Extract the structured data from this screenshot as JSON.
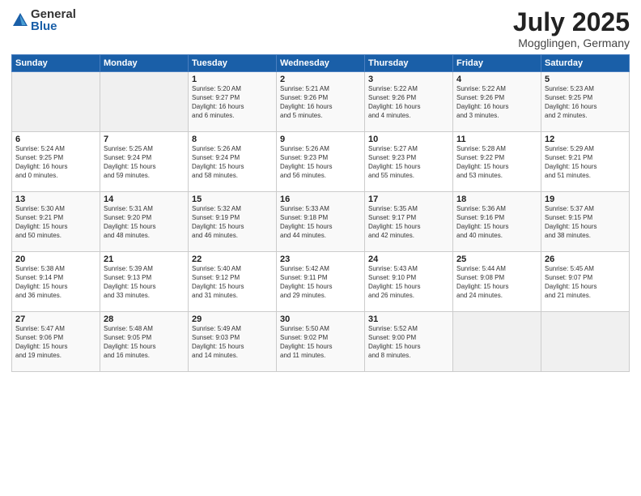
{
  "header": {
    "logo_general": "General",
    "logo_blue": "Blue",
    "month_year": "July 2025",
    "location": "Mogglingen, Germany"
  },
  "weekdays": [
    "Sunday",
    "Monday",
    "Tuesday",
    "Wednesday",
    "Thursday",
    "Friday",
    "Saturday"
  ],
  "weeks": [
    [
      {
        "day": "",
        "info": ""
      },
      {
        "day": "",
        "info": ""
      },
      {
        "day": "1",
        "info": "Sunrise: 5:20 AM\nSunset: 9:27 PM\nDaylight: 16 hours\nand 6 minutes."
      },
      {
        "day": "2",
        "info": "Sunrise: 5:21 AM\nSunset: 9:26 PM\nDaylight: 16 hours\nand 5 minutes."
      },
      {
        "day": "3",
        "info": "Sunrise: 5:22 AM\nSunset: 9:26 PM\nDaylight: 16 hours\nand 4 minutes."
      },
      {
        "day": "4",
        "info": "Sunrise: 5:22 AM\nSunset: 9:26 PM\nDaylight: 16 hours\nand 3 minutes."
      },
      {
        "day": "5",
        "info": "Sunrise: 5:23 AM\nSunset: 9:25 PM\nDaylight: 16 hours\nand 2 minutes."
      }
    ],
    [
      {
        "day": "6",
        "info": "Sunrise: 5:24 AM\nSunset: 9:25 PM\nDaylight: 16 hours\nand 0 minutes."
      },
      {
        "day": "7",
        "info": "Sunrise: 5:25 AM\nSunset: 9:24 PM\nDaylight: 15 hours\nand 59 minutes."
      },
      {
        "day": "8",
        "info": "Sunrise: 5:26 AM\nSunset: 9:24 PM\nDaylight: 15 hours\nand 58 minutes."
      },
      {
        "day": "9",
        "info": "Sunrise: 5:26 AM\nSunset: 9:23 PM\nDaylight: 15 hours\nand 56 minutes."
      },
      {
        "day": "10",
        "info": "Sunrise: 5:27 AM\nSunset: 9:23 PM\nDaylight: 15 hours\nand 55 minutes."
      },
      {
        "day": "11",
        "info": "Sunrise: 5:28 AM\nSunset: 9:22 PM\nDaylight: 15 hours\nand 53 minutes."
      },
      {
        "day": "12",
        "info": "Sunrise: 5:29 AM\nSunset: 9:21 PM\nDaylight: 15 hours\nand 51 minutes."
      }
    ],
    [
      {
        "day": "13",
        "info": "Sunrise: 5:30 AM\nSunset: 9:21 PM\nDaylight: 15 hours\nand 50 minutes."
      },
      {
        "day": "14",
        "info": "Sunrise: 5:31 AM\nSunset: 9:20 PM\nDaylight: 15 hours\nand 48 minutes."
      },
      {
        "day": "15",
        "info": "Sunrise: 5:32 AM\nSunset: 9:19 PM\nDaylight: 15 hours\nand 46 minutes."
      },
      {
        "day": "16",
        "info": "Sunrise: 5:33 AM\nSunset: 9:18 PM\nDaylight: 15 hours\nand 44 minutes."
      },
      {
        "day": "17",
        "info": "Sunrise: 5:35 AM\nSunset: 9:17 PM\nDaylight: 15 hours\nand 42 minutes."
      },
      {
        "day": "18",
        "info": "Sunrise: 5:36 AM\nSunset: 9:16 PM\nDaylight: 15 hours\nand 40 minutes."
      },
      {
        "day": "19",
        "info": "Sunrise: 5:37 AM\nSunset: 9:15 PM\nDaylight: 15 hours\nand 38 minutes."
      }
    ],
    [
      {
        "day": "20",
        "info": "Sunrise: 5:38 AM\nSunset: 9:14 PM\nDaylight: 15 hours\nand 36 minutes."
      },
      {
        "day": "21",
        "info": "Sunrise: 5:39 AM\nSunset: 9:13 PM\nDaylight: 15 hours\nand 33 minutes."
      },
      {
        "day": "22",
        "info": "Sunrise: 5:40 AM\nSunset: 9:12 PM\nDaylight: 15 hours\nand 31 minutes."
      },
      {
        "day": "23",
        "info": "Sunrise: 5:42 AM\nSunset: 9:11 PM\nDaylight: 15 hours\nand 29 minutes."
      },
      {
        "day": "24",
        "info": "Sunrise: 5:43 AM\nSunset: 9:10 PM\nDaylight: 15 hours\nand 26 minutes."
      },
      {
        "day": "25",
        "info": "Sunrise: 5:44 AM\nSunset: 9:08 PM\nDaylight: 15 hours\nand 24 minutes."
      },
      {
        "day": "26",
        "info": "Sunrise: 5:45 AM\nSunset: 9:07 PM\nDaylight: 15 hours\nand 21 minutes."
      }
    ],
    [
      {
        "day": "27",
        "info": "Sunrise: 5:47 AM\nSunset: 9:06 PM\nDaylight: 15 hours\nand 19 minutes."
      },
      {
        "day": "28",
        "info": "Sunrise: 5:48 AM\nSunset: 9:05 PM\nDaylight: 15 hours\nand 16 minutes."
      },
      {
        "day": "29",
        "info": "Sunrise: 5:49 AM\nSunset: 9:03 PM\nDaylight: 15 hours\nand 14 minutes."
      },
      {
        "day": "30",
        "info": "Sunrise: 5:50 AM\nSunset: 9:02 PM\nDaylight: 15 hours\nand 11 minutes."
      },
      {
        "day": "31",
        "info": "Sunrise: 5:52 AM\nSunset: 9:00 PM\nDaylight: 15 hours\nand 8 minutes."
      },
      {
        "day": "",
        "info": ""
      },
      {
        "day": "",
        "info": ""
      }
    ]
  ]
}
